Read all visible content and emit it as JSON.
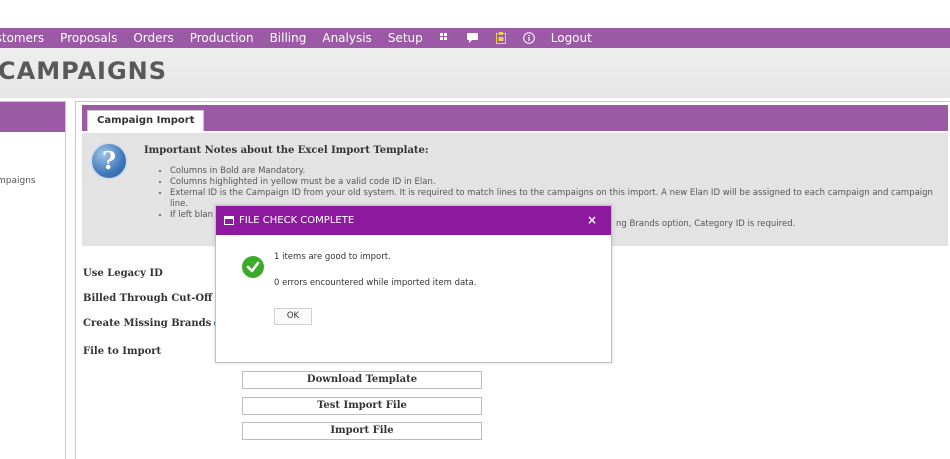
{
  "nav": {
    "items": [
      "ustomers",
      "Proposals",
      "Orders",
      "Production",
      "Billing",
      "Analysis",
      "Setup"
    ],
    "icons": [
      "grid-icon",
      "chat-icon",
      "clipboard-icon",
      "info-icon"
    ],
    "logout": "Logout"
  },
  "page": {
    "title": "CAMPAIGNS"
  },
  "left_panel": {
    "item": "mpaigns"
  },
  "tab": {
    "label": "Campaign Import"
  },
  "notes": {
    "title": "Important Notes about the Excel Import Template:",
    "items": [
      "Columns in Bold are Mandatory.",
      "Columns highlighted in yellow must be a valid code ID in Elan.",
      "External ID is the Campaign ID from your old system. It is required to match lines to the campaigns on this import. A new Elan ID will be assigned to each campaign and campaign line.",
      "If left blan",
      "ng Brands option, Category ID is required."
    ]
  },
  "form": {
    "use_legacy_id": "Use Legacy ID",
    "billed_through_cutoff": "Billed Through Cut-Off",
    "create_missing_brands": "Create Missing Brands",
    "file_to_import": "File to Import"
  },
  "buttons": {
    "download_template": "Download Template",
    "test_import_file": "Test Import File",
    "import_file": "Import File"
  },
  "modal": {
    "title": "FILE CHECK COMPLETE",
    "close": "×",
    "line1": "1 items are good to import.",
    "line2": "0 errors encountered while imported item data.",
    "ok": "OK"
  },
  "colors": {
    "nav_bg": "#9b59a6",
    "modal_header": "#8d1a9e",
    "success_green": "#3eaa2c",
    "help_blue": "#3f79b8"
  }
}
